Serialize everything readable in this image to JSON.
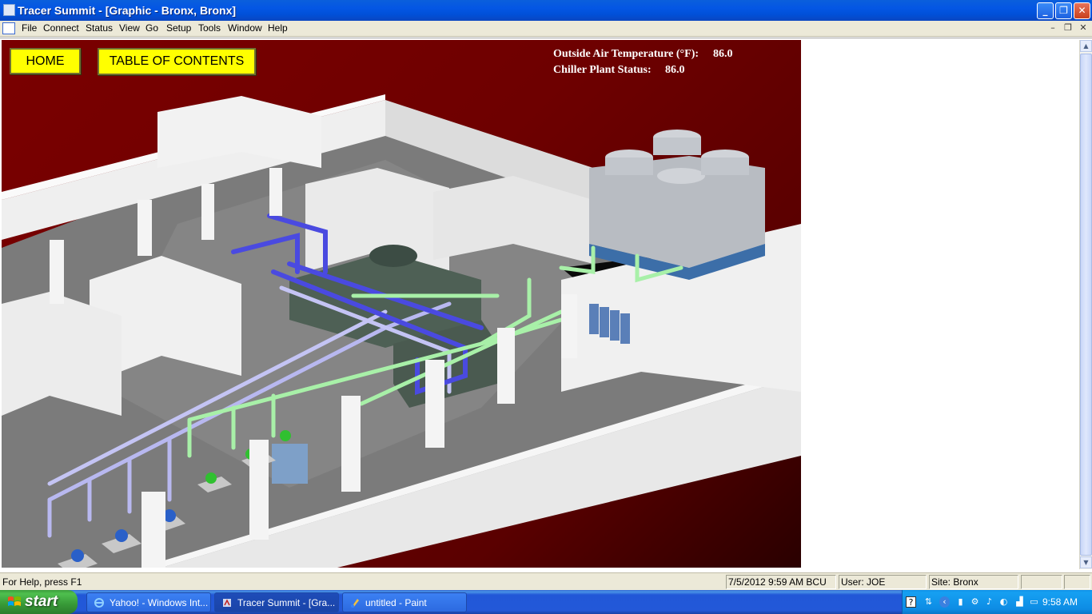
{
  "window": {
    "title": "Tracer Summit - [Graphic - Bronx, Bronx]",
    "minimize": "_",
    "restore": "❐",
    "close": "✕"
  },
  "menu": {
    "items": [
      "File",
      "Connect",
      "Status",
      "View",
      "Go",
      "Setup",
      "Tools",
      "Window",
      "Help"
    ],
    "mdi_minimize": "–",
    "mdi_restore": "❐",
    "mdi_close": "✕"
  },
  "graphic": {
    "home_label": "HOME",
    "toc_label": "TABLE OF CONTENTS",
    "oat_label": "Outside Air Temperature (°F):",
    "oat_value": "86.0",
    "chiller_label": "Chiller Plant Status:",
    "chiller_value": "86.0",
    "colors": {
      "background": "#6e0000",
      "button": "#ffff00",
      "chilled_water_pipe": "#b8b8f0",
      "supply_pipe": "#4a4ae0",
      "condenser_pipe": "#a8f0a8",
      "walls": "#ececec",
      "floor": "#7a7a7a"
    }
  },
  "statusbar": {
    "help": "For Help, press F1",
    "datetime": "7/5/2012 9:59 AM BCU",
    "user": "User: JOE",
    "site": "Site: Bronx"
  },
  "taskbar": {
    "start_label": "start",
    "tasks": [
      {
        "label": "Yahoo! - Windows Int...",
        "icon": "internet-explorer-icon"
      },
      {
        "label": "Tracer Summit - [Gra...",
        "icon": "tracer-summit-icon"
      },
      {
        "label": "untitled - Paint",
        "icon": "paint-icon"
      }
    ],
    "clock": "9:58 AM"
  }
}
